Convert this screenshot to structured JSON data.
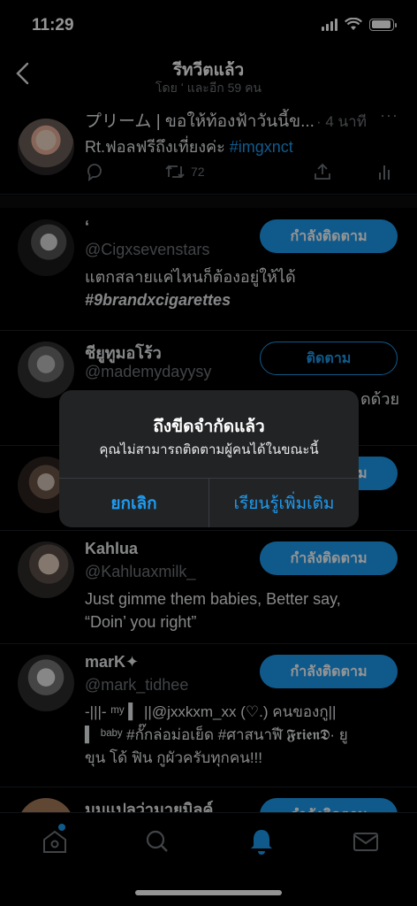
{
  "status_bar": {
    "time": "11:29"
  },
  "header": {
    "title": "รีทวีตแล้ว",
    "subtitle": "โดย ʻ และอีก 59 คน"
  },
  "tweet": {
    "name": "プリーム | ขอให้ท้องฟ้าวันนี้ข...",
    "time": "· 4 นาที",
    "more": "···",
    "text_plain": "Rt.ฟอลฟรีถึงเที่ยงค่ะ ",
    "hashtag": "#imgxnct",
    "retweet_count": "72",
    "icons": [
      "reply-icon",
      "retweet-icon",
      "share-icon",
      "analytics-icon"
    ]
  },
  "users": [
    {
      "name": "ʻ",
      "handle": "@Cigxsevenstars",
      "bio_line1": "แตกสลายแค่ไหนก็ต้องอยู่ให้ได้",
      "bio_line2": "#9brandxcigarettes",
      "button": "กำลังติดตาม",
      "state": "following"
    },
    {
      "name": "ชียูทูมอโร้ว",
      "handle": "@mademydayysy",
      "bio_line1": "",
      "bio_line2": "",
      "button": "ติดตาม",
      "state": "follow",
      "bio_fragment": "ดด้วย"
    },
    {
      "name": "",
      "handle": "",
      "bio_line1": "",
      "bio_line2": "",
      "button": "กำลังติดตาม",
      "state": "following"
    },
    {
      "name": "Kahlua",
      "handle": "@Kahluaxmilk_",
      "bio_line1": "Just gimme them babies, Better say,",
      "bio_line2": "“Doin’ you right”",
      "button": "กำลังติดตาม",
      "state": "following"
    },
    {
      "name": "marK✦",
      "handle": "@mark_tidhee",
      "bio_line1": "-|||- ᵐʸ ▍ ||@jxxkxm_xx (♡.) คนของกู||",
      "bio_line2": "▍ ᵇᵃᵇʸ #กั๊กล่อม่อเย็ด #ศาสนาฬี 𝕱𝖗𝖎𝖊𝖓𝕯· ยู",
      "bio_line3": "ขุน โด้ ฟิน กูผัวครับทุกคน!!!",
      "button": "กำลังติดตาม",
      "state": "following"
    },
    {
      "name": "มมแปลว่ามายมิลค์",
      "handle": "",
      "bio_line1": "",
      "bio_line2": "",
      "button": "กำลังติดตาม",
      "state": "following"
    }
  ],
  "alert": {
    "title": "ถึงขีดจำกัดแล้ว",
    "message": "คุณไม่สามารถติดตามผู้คนได้ในขณะนี้",
    "cancel": "ยกเลิก",
    "learn_more": "เรียนรู้เพิ่มเติม"
  },
  "tab_bar": {
    "icons": [
      "home-icon",
      "search-icon",
      "notifications-icon",
      "messages-icon"
    ]
  },
  "colors": {
    "accent": "#1d9bf0",
    "background": "#000000",
    "secondary_text": "#71767b"
  }
}
